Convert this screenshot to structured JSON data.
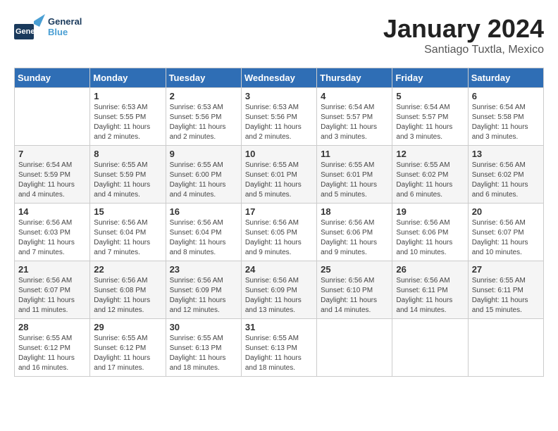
{
  "header": {
    "logo_line1": "General",
    "logo_line2": "Blue",
    "month_title": "January 2024",
    "location": "Santiago Tuxtla, Mexico"
  },
  "days_of_week": [
    "Sunday",
    "Monday",
    "Tuesday",
    "Wednesday",
    "Thursday",
    "Friday",
    "Saturday"
  ],
  "weeks": [
    [
      {
        "day": "",
        "info": ""
      },
      {
        "day": "1",
        "info": "Sunrise: 6:53 AM\nSunset: 5:55 PM\nDaylight: 11 hours\nand 2 minutes."
      },
      {
        "day": "2",
        "info": "Sunrise: 6:53 AM\nSunset: 5:56 PM\nDaylight: 11 hours\nand 2 minutes."
      },
      {
        "day": "3",
        "info": "Sunrise: 6:53 AM\nSunset: 5:56 PM\nDaylight: 11 hours\nand 2 minutes."
      },
      {
        "day": "4",
        "info": "Sunrise: 6:54 AM\nSunset: 5:57 PM\nDaylight: 11 hours\nand 3 minutes."
      },
      {
        "day": "5",
        "info": "Sunrise: 6:54 AM\nSunset: 5:57 PM\nDaylight: 11 hours\nand 3 minutes."
      },
      {
        "day": "6",
        "info": "Sunrise: 6:54 AM\nSunset: 5:58 PM\nDaylight: 11 hours\nand 3 minutes."
      }
    ],
    [
      {
        "day": "7",
        "info": "Sunrise: 6:54 AM\nSunset: 5:59 PM\nDaylight: 11 hours\nand 4 minutes."
      },
      {
        "day": "8",
        "info": "Sunrise: 6:55 AM\nSunset: 5:59 PM\nDaylight: 11 hours\nand 4 minutes."
      },
      {
        "day": "9",
        "info": "Sunrise: 6:55 AM\nSunset: 6:00 PM\nDaylight: 11 hours\nand 4 minutes."
      },
      {
        "day": "10",
        "info": "Sunrise: 6:55 AM\nSunset: 6:01 PM\nDaylight: 11 hours\nand 5 minutes."
      },
      {
        "day": "11",
        "info": "Sunrise: 6:55 AM\nSunset: 6:01 PM\nDaylight: 11 hours\nand 5 minutes."
      },
      {
        "day": "12",
        "info": "Sunrise: 6:55 AM\nSunset: 6:02 PM\nDaylight: 11 hours\nand 6 minutes."
      },
      {
        "day": "13",
        "info": "Sunrise: 6:56 AM\nSunset: 6:02 PM\nDaylight: 11 hours\nand 6 minutes."
      }
    ],
    [
      {
        "day": "14",
        "info": "Sunrise: 6:56 AM\nSunset: 6:03 PM\nDaylight: 11 hours\nand 7 minutes."
      },
      {
        "day": "15",
        "info": "Sunrise: 6:56 AM\nSunset: 6:04 PM\nDaylight: 11 hours\nand 7 minutes."
      },
      {
        "day": "16",
        "info": "Sunrise: 6:56 AM\nSunset: 6:04 PM\nDaylight: 11 hours\nand 8 minutes."
      },
      {
        "day": "17",
        "info": "Sunrise: 6:56 AM\nSunset: 6:05 PM\nDaylight: 11 hours\nand 9 minutes."
      },
      {
        "day": "18",
        "info": "Sunrise: 6:56 AM\nSunset: 6:06 PM\nDaylight: 11 hours\nand 9 minutes."
      },
      {
        "day": "19",
        "info": "Sunrise: 6:56 AM\nSunset: 6:06 PM\nDaylight: 11 hours\nand 10 minutes."
      },
      {
        "day": "20",
        "info": "Sunrise: 6:56 AM\nSunset: 6:07 PM\nDaylight: 11 hours\nand 10 minutes."
      }
    ],
    [
      {
        "day": "21",
        "info": "Sunrise: 6:56 AM\nSunset: 6:07 PM\nDaylight: 11 hours\nand 11 minutes."
      },
      {
        "day": "22",
        "info": "Sunrise: 6:56 AM\nSunset: 6:08 PM\nDaylight: 11 hours\nand 12 minutes."
      },
      {
        "day": "23",
        "info": "Sunrise: 6:56 AM\nSunset: 6:09 PM\nDaylight: 11 hours\nand 12 minutes."
      },
      {
        "day": "24",
        "info": "Sunrise: 6:56 AM\nSunset: 6:09 PM\nDaylight: 11 hours\nand 13 minutes."
      },
      {
        "day": "25",
        "info": "Sunrise: 6:56 AM\nSunset: 6:10 PM\nDaylight: 11 hours\nand 14 minutes."
      },
      {
        "day": "26",
        "info": "Sunrise: 6:56 AM\nSunset: 6:11 PM\nDaylight: 11 hours\nand 14 minutes."
      },
      {
        "day": "27",
        "info": "Sunrise: 6:55 AM\nSunset: 6:11 PM\nDaylight: 11 hours\nand 15 minutes."
      }
    ],
    [
      {
        "day": "28",
        "info": "Sunrise: 6:55 AM\nSunset: 6:12 PM\nDaylight: 11 hours\nand 16 minutes."
      },
      {
        "day": "29",
        "info": "Sunrise: 6:55 AM\nSunset: 6:12 PM\nDaylight: 11 hours\nand 17 minutes."
      },
      {
        "day": "30",
        "info": "Sunrise: 6:55 AM\nSunset: 6:13 PM\nDaylight: 11 hours\nand 18 minutes."
      },
      {
        "day": "31",
        "info": "Sunrise: 6:55 AM\nSunset: 6:13 PM\nDaylight: 11 hours\nand 18 minutes."
      },
      {
        "day": "",
        "info": ""
      },
      {
        "day": "",
        "info": ""
      },
      {
        "day": "",
        "info": ""
      }
    ]
  ]
}
